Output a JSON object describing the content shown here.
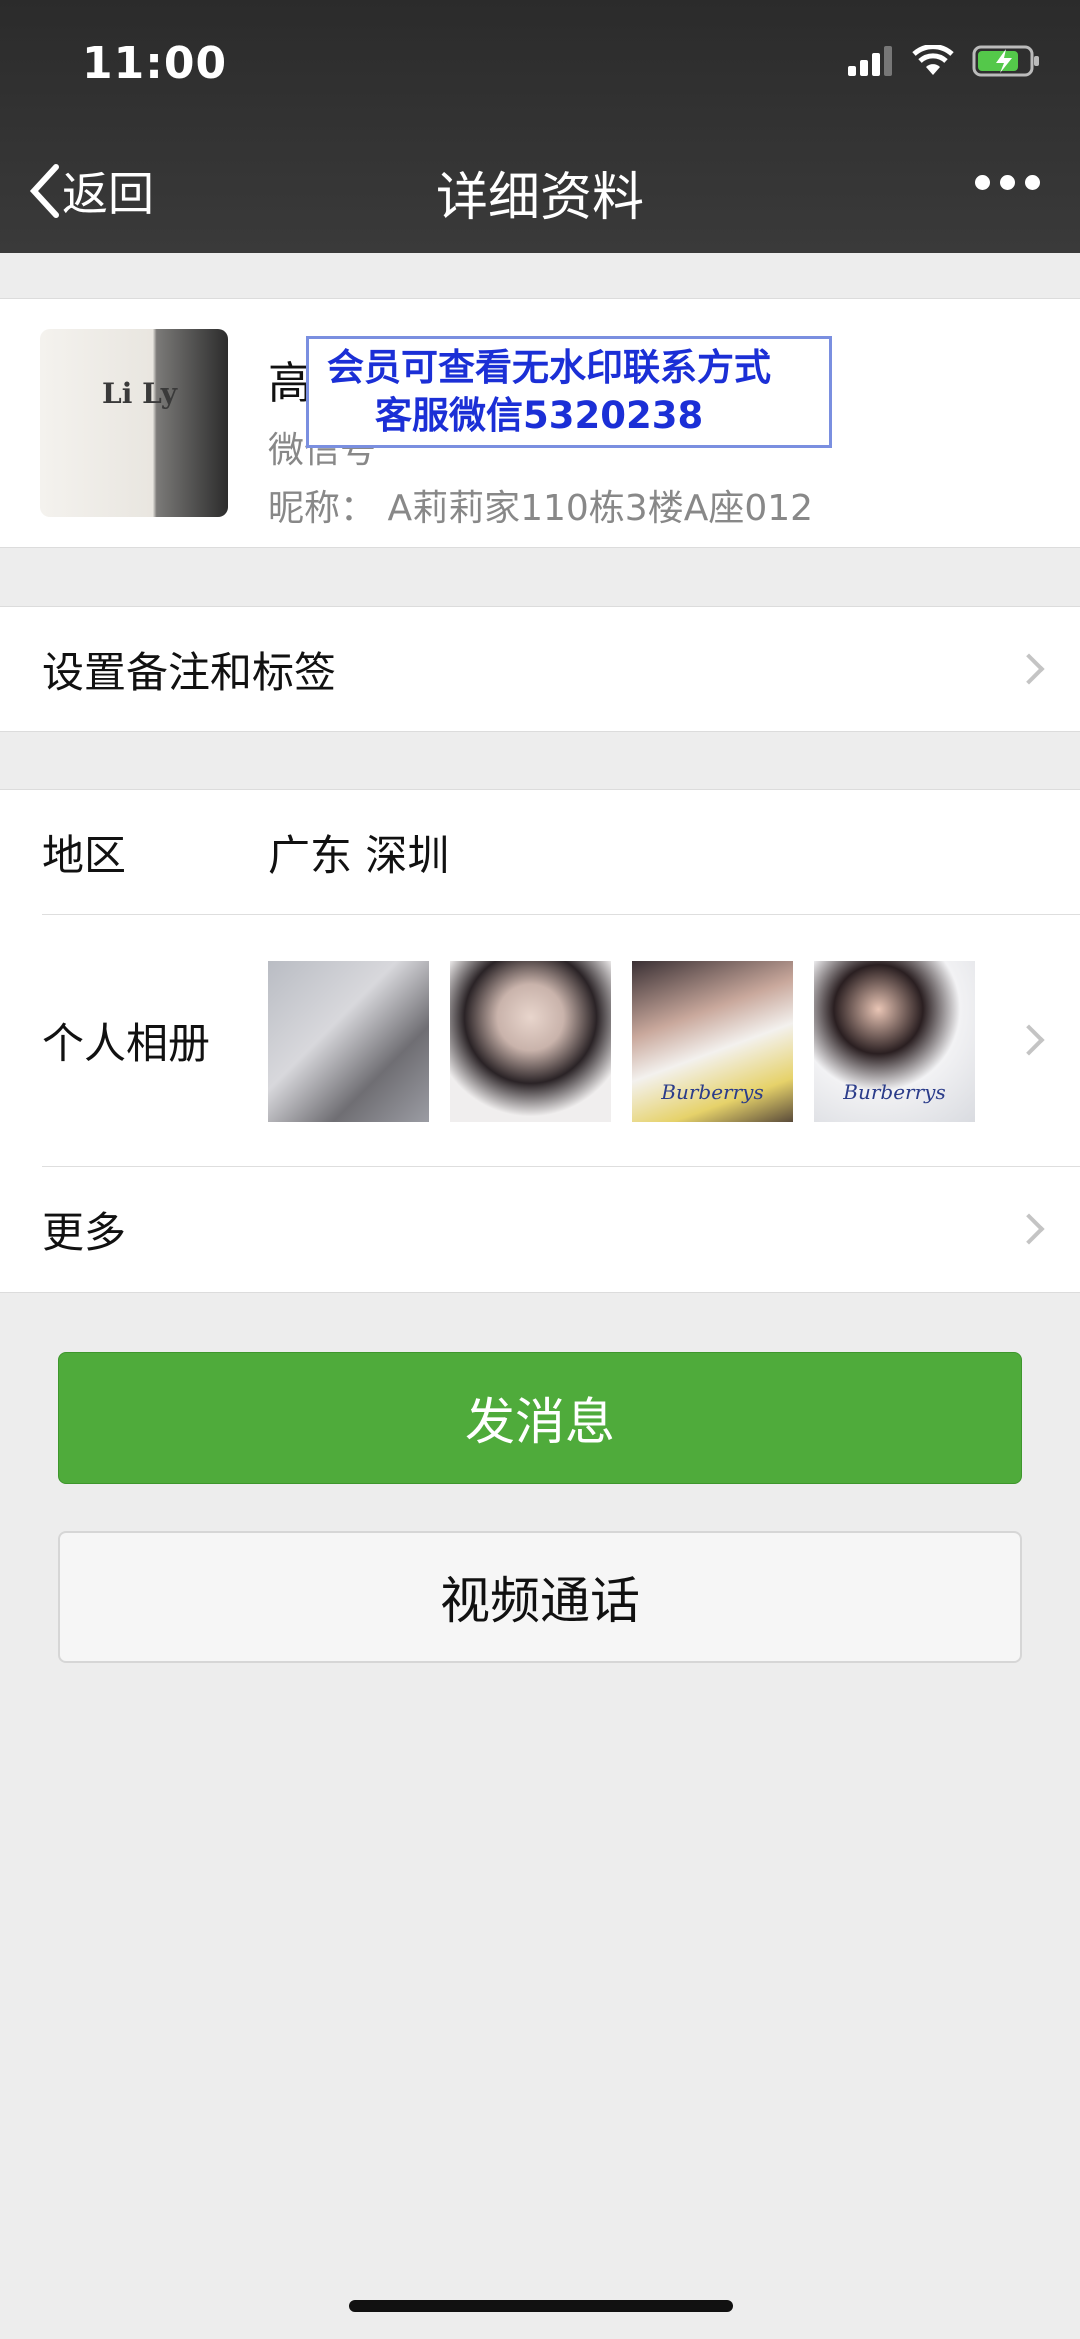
{
  "status_bar": {
    "time": "11:00",
    "icons": [
      "signal-icon",
      "wifi-icon",
      "battery-charging-icon"
    ]
  },
  "nav": {
    "back_label": "返回",
    "title": "详细资料",
    "more_icon": "ellipsis-icon"
  },
  "profile": {
    "avatar_text": "Li Ly",
    "name": "高",
    "wechat_id": "微信号",
    "nickname": "昵称： A莉莉家110栋3楼A座012"
  },
  "watermark": {
    "line1": "会员可查看无水印联系方式",
    "line2": "客服微信5320238"
  },
  "tags_row": {
    "label": "设置备注和标签"
  },
  "region_row": {
    "label": "地区",
    "value": "广东 深圳"
  },
  "album_row": {
    "label": "个人相册",
    "photos": [
      {
        "caption": ""
      },
      {
        "caption": ""
      },
      {
        "caption": "Burberrys"
      },
      {
        "caption": "Burberrys"
      }
    ]
  },
  "more_row": {
    "label": "更多"
  },
  "buttons": {
    "message": "发消息",
    "video_call": "视频通话"
  },
  "colors": {
    "accent_green": "#4fab3b",
    "watermark_blue": "#1b2fd6",
    "topbar": "#2f2f2f"
  }
}
